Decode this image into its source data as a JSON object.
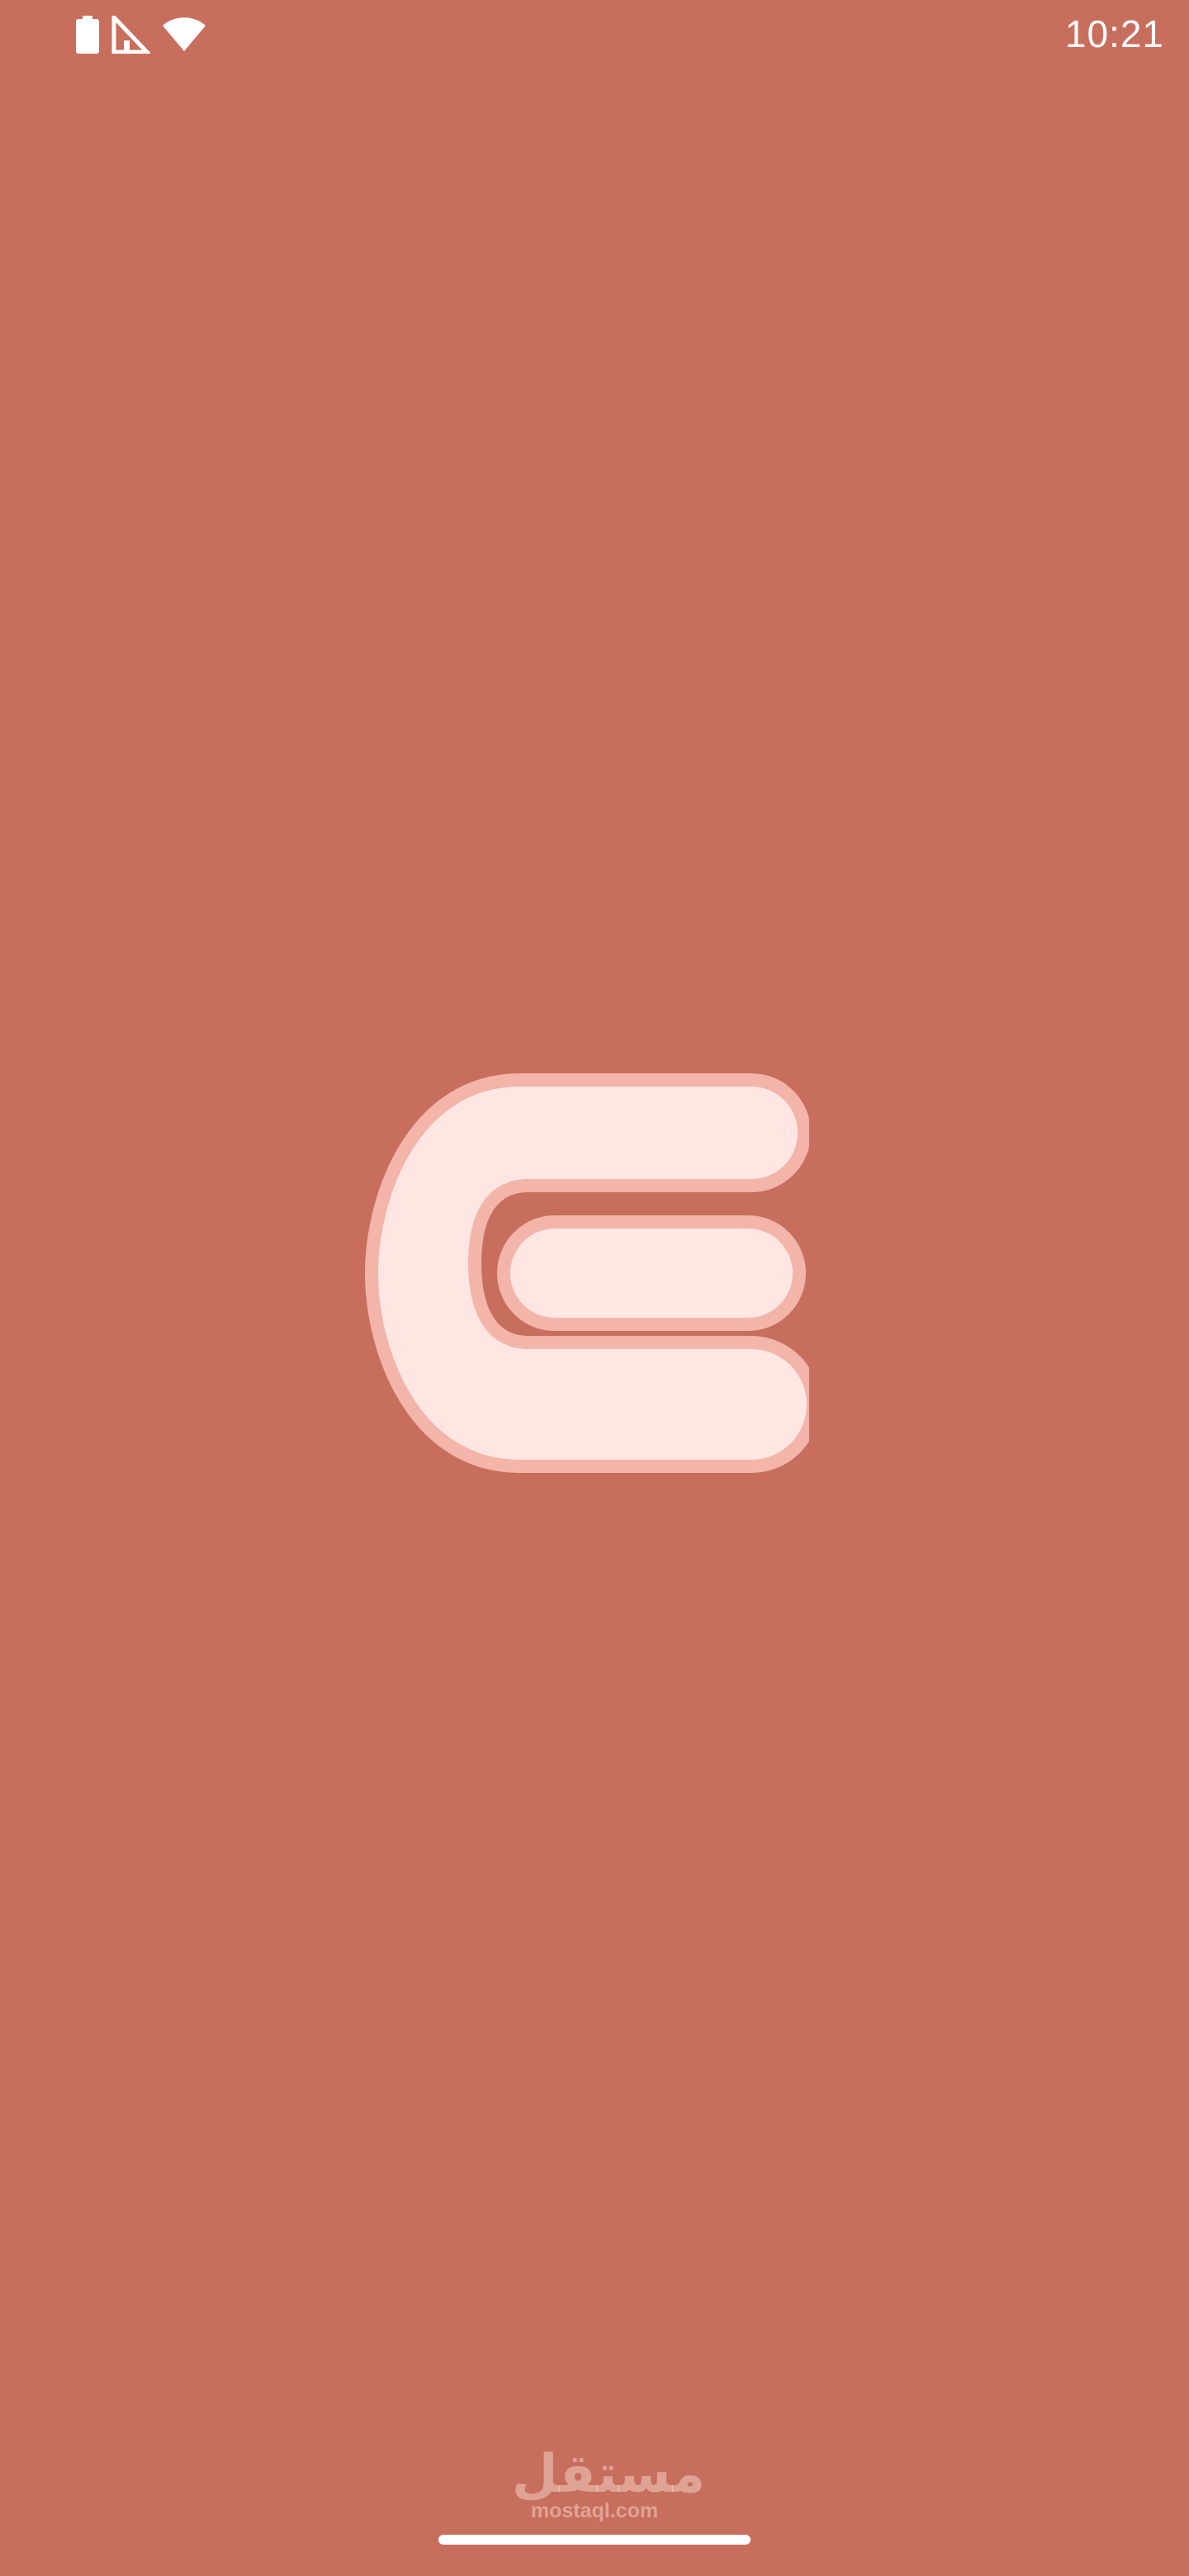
{
  "status_bar": {
    "time": "10:21",
    "icons": [
      "battery-icon",
      "cellular-signal-icon",
      "wifi-icon"
    ]
  },
  "splash": {
    "logo_icon": "app-logo-e-icon",
    "background_color": "#C86E5D",
    "logo_fill_color": "#FFE6E2",
    "logo_outline_color": "#F3B5A9"
  },
  "watermark": {
    "arabic": "مستقل",
    "latin": "mostaql.com"
  }
}
